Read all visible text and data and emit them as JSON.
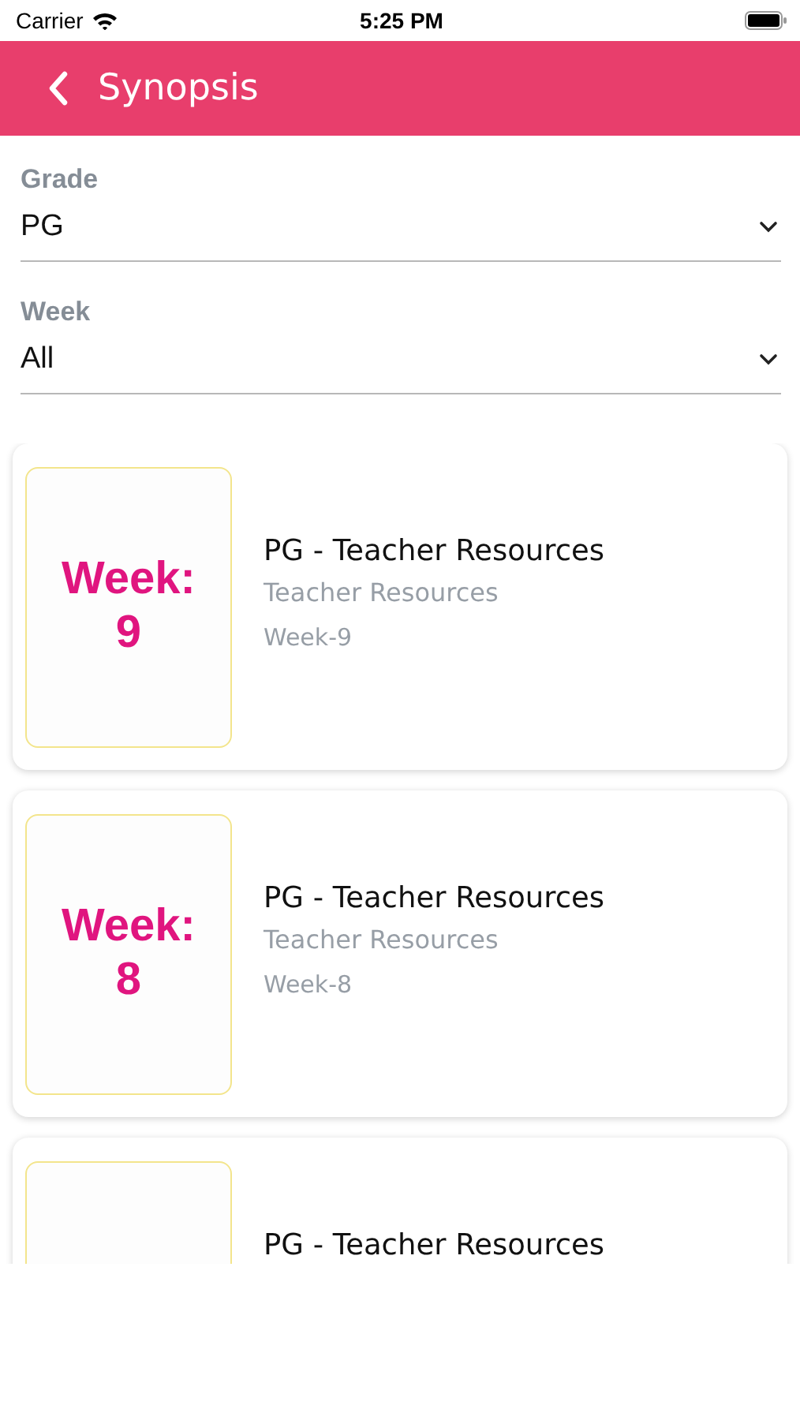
{
  "status_bar": {
    "carrier": "Carrier",
    "time": "5:25 PM"
  },
  "header": {
    "title": "Synopsis"
  },
  "filters": [
    {
      "label": "Grade",
      "value": "PG"
    },
    {
      "label": "Week",
      "value": "All"
    }
  ],
  "cards": [
    {
      "badge": [
        "Week:",
        "9"
      ],
      "title": "PG - Teacher Resources",
      "subtitle": "Teacher Resources",
      "week": "Week-9"
    },
    {
      "badge": [
        "Week:",
        "8"
      ],
      "title": "PG - Teacher Resources",
      "subtitle": "Teacher Resources",
      "week": "Week-8"
    },
    {
      "title": "PG - Teacher Resources"
    }
  ]
}
